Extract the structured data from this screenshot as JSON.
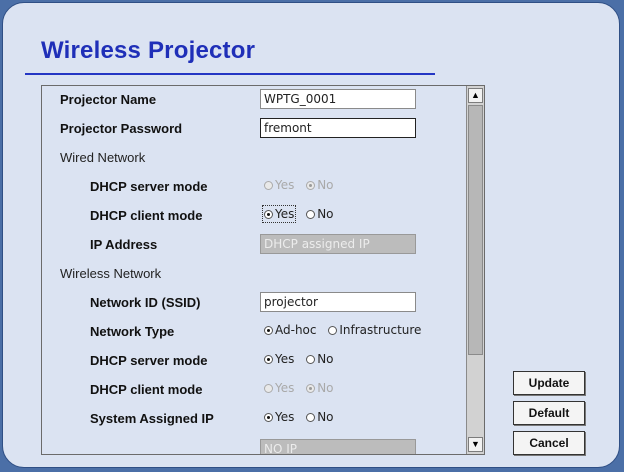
{
  "window": {
    "title": "Wireless Projector"
  },
  "settings": {
    "projector_name_label": "Projector Name",
    "projector_name_value": "WPTG_0001",
    "projector_password_label": "Projector Password",
    "projector_password_value": "fremont",
    "wired_network_label": "Wired Network",
    "wired": {
      "dhcp_server_label": "DHCP server mode",
      "dhcp_server_yes": "Yes",
      "dhcp_server_no": "No",
      "dhcp_client_label": "DHCP client mode",
      "dhcp_client_yes": "Yes",
      "dhcp_client_no": "No",
      "ip_label": "IP Address",
      "ip_value": "DHCP assigned IP"
    },
    "wireless_network_label": "Wireless Network",
    "wireless": {
      "ssid_label": "Network ID (SSID)",
      "ssid_value": "projector",
      "type_label": "Network Type",
      "type_adhoc": "Ad-hoc",
      "type_infra": "Infrastructure",
      "dhcp_server_label": "DHCP server mode",
      "dhcp_server_yes": "Yes",
      "dhcp_server_no": "No",
      "dhcp_client_label": "DHCP client mode",
      "dhcp_client_yes": "Yes",
      "dhcp_client_no": "No",
      "sys_ip_label": "System Assigned IP",
      "sys_ip_yes": "Yes",
      "sys_ip_no": "No",
      "ip_partial_value": "NO IP"
    }
  },
  "scroll": {
    "up_arrow": "▲",
    "down_arrow": "▼"
  },
  "buttons": {
    "update": "Update",
    "default": "Default",
    "cancel": "Cancel"
  },
  "colors": {
    "accent": "#1f2fb8",
    "background": "#4b6fa7",
    "panel": "#dbe3f2"
  }
}
